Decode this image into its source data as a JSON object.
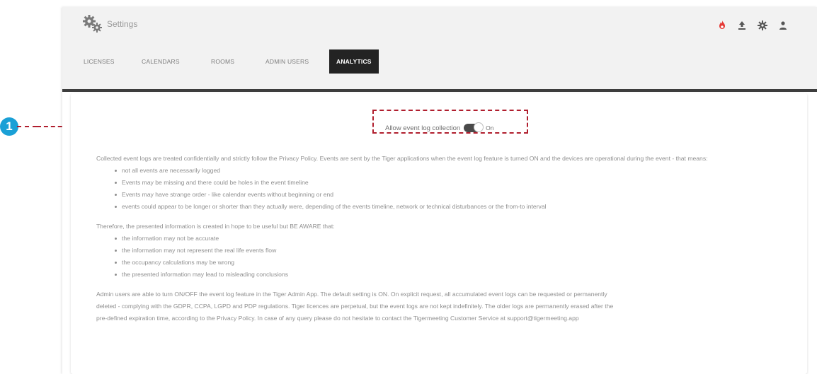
{
  "header": {
    "title": "Settings",
    "icons": [
      "gear-icon",
      "fire-icon",
      "upload-icon",
      "settings-icon",
      "user-icon"
    ],
    "accent": "#e53935"
  },
  "tabs": [
    {
      "label": "LICENSES"
    },
    {
      "label": "CALENDARS"
    },
    {
      "label": "ROOMS"
    },
    {
      "label": "ADMIN USERS"
    },
    {
      "label": "ANALYTICS",
      "active": true
    }
  ],
  "analytics": {
    "toggle_label": "Allow event log collection",
    "toggle_state": "On",
    "intro": "Collected event logs are treated confidentially and strictly follow the Privacy Policy. Events are sent by the Tiger applications when the event log feature is turned ON and the devices are operational during the event - that means:",
    "bullets_1": [
      "not all events are necessarily logged",
      "Events may be missing and there could be holes in the event timeline",
      "Events may have strange order - like calendar events without beginning or end",
      "events could appear to be longer or shorter than they actually were, depending of the events timeline, network or technical disturbances or the from-to interval"
    ],
    "therefore": "Therefore, the presented information is created in hope to be useful but BE AWARE that:",
    "bullets_2": [
      "the information may not be accurate",
      "the information may not represent the real life events flow",
      "the occupancy calculations may be wrong",
      "the presented information may lead to misleading conclusions"
    ],
    "footer_1": "Admin users are able to turn ON/OFF the event log feature in the Tiger Admin App. The default setting is ON. On explicit request, all accumulated event logs can be requested or permanently",
    "footer_2": "deleted - complying with the GDPR, CCPA, LGPD and PDP regulations. Tiger licences are perpetual, but the event logs are not kept indefinitely. The older logs are permanently erased after the",
    "footer_3": "pre-defined expiration time, according to the Privacy Policy. In case of any query please do not hesitate to contact the Tigermeeting Customer Service at support@tigermeeting.app"
  },
  "callout": {
    "number": "1",
    "color": "#b01e2e",
    "badge_color": "#1aa0d6"
  }
}
